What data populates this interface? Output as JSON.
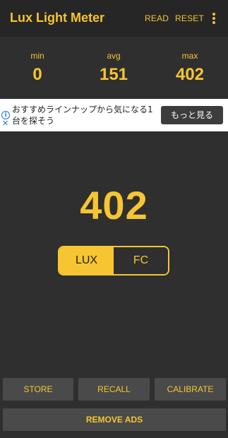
{
  "app": {
    "title": "Lux Light Meter",
    "actions": {
      "read": "READ",
      "reset": "RESET"
    }
  },
  "stats": {
    "min_label": "min",
    "min_value": "0",
    "avg_label": "avg",
    "avg_value": "151",
    "max_label": "max",
    "max_value": "402"
  },
  "ad": {
    "text": "おすすめラインナップから気になる1台を探そう",
    "button": "もっと見る",
    "info_icon": "info-icon",
    "close_icon": "close-icon"
  },
  "reading": {
    "value": "402"
  },
  "units": {
    "lux": "LUX",
    "fc": "FC",
    "selected": "LUX"
  },
  "buttons": {
    "store": "STORE",
    "recall": "RECALL",
    "calibrate": "CALIBRATE",
    "remove_ads": "REMOVE ADS"
  },
  "colors": {
    "accent": "#f6c531",
    "background": "#2f2f2f",
    "toolbar": "#262626",
    "button": "#4a4a4a"
  }
}
